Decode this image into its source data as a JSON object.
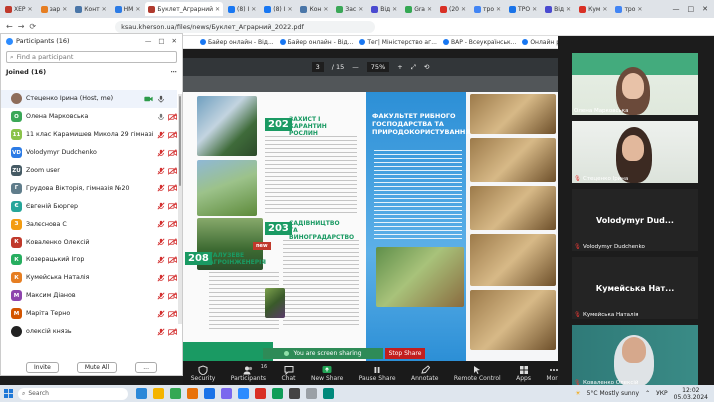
{
  "browser": {
    "tabs": [
      {
        "label": "ХЕР",
        "color": "#c0392b"
      },
      {
        "label": "зар",
        "color": "#e67e22"
      },
      {
        "label": "Конт",
        "color": "#4a76a8"
      },
      {
        "label": "НМ",
        "color": "#2c7be5"
      },
      {
        "label": "Буклет_Аграрний",
        "color": "#b03a2e",
        "active": true
      },
      {
        "label": "(8) I",
        "color": "#1877f2"
      },
      {
        "label": "(8) I",
        "color": "#1877f2"
      },
      {
        "label": "Кон",
        "color": "#4a76a8"
      },
      {
        "label": "Зас",
        "color": "#3aa757"
      },
      {
        "label": "Від",
        "color": "#4a4ad0"
      },
      {
        "label": "Gra",
        "color": "#34a853"
      },
      {
        "label": "(20",
        "color": "#d93025"
      },
      {
        "label": "тро",
        "color": "#4285f4"
      },
      {
        "label": "TPO",
        "color": "#1a73e8"
      },
      {
        "label": "Від",
        "color": "#4a4ad0"
      },
      {
        "label": "Кум",
        "color": "#d93025"
      },
      {
        "label": "тро",
        "color": "#4285f4"
      }
    ],
    "url": "ksau.kherson.ua/files/news/Буклет_Аграрний_2022.pdf",
    "bookmarks": [
      "Байер онлайн - Від...",
      "Байер онлайн - Від...",
      "Тег| Міністерство аг...",
      "ВАР - Всеукраїнськ...",
      "Онлайн резервуван..."
    ]
  },
  "pdf": {
    "page_current": "3",
    "page_total": "/ 15",
    "zoom": "75%",
    "sections": {
      "s202_num": "202",
      "s202_title": "ЗАХИСТ І КАРАНТИН РОСЛИН",
      "s203_num": "203",
      "s203_title": "САДІВНИЦТВО ТА ВИНОГРАДАРСТВО",
      "s208_num": "208",
      "s208_title": "ГАЛУЗЕВЕ АГРОІНЖЕНЕРІЯ",
      "new_badge": "new"
    },
    "faculty_title": "ФАКУЛЬТЕТ РИБНОГО ГОСПОДАРСТВА ТА ПРИРОДОКОРИСТУВАННЯ"
  },
  "sharing": {
    "banner": "You are screen sharing",
    "stop": "Stop Share"
  },
  "participants_panel": {
    "title": "Participants (16)",
    "search_placeholder": "Find a participant",
    "joined_label": "Joined (16)",
    "invite": "Invite",
    "mute_all": "Mute All",
    "more": "...",
    "list": [
      {
        "initials": "",
        "name": "Стеценко Ірина (Host, me)",
        "color": "#8e6d5a",
        "mic": "on",
        "video": "on",
        "highlight": true
      },
      {
        "initials": "О",
        "name": "Олена Марковська",
        "color": "#3aa757",
        "mic": "muted-plain",
        "video": "off"
      },
      {
        "initials": "11",
        "name": "11 клас Карамишев Микола 29 гімназія",
        "color": "#8bc34a",
        "mic": "off",
        "video": "off"
      },
      {
        "initials": "VD",
        "name": "Volodymyr Dudchenko",
        "color": "#2c7be5",
        "mic": "off",
        "video": "off"
      },
      {
        "initials": "ZU",
        "name": "Zoom user",
        "color": "#455a64",
        "mic": "off",
        "video": "off"
      },
      {
        "initials": "Г",
        "name": "Грудова Вікторія, гімназія №20",
        "color": "#607d8b",
        "mic": "off",
        "video": "off"
      },
      {
        "initials": "Є",
        "name": "Євгеній Бюргер",
        "color": "#26a69a",
        "mic": "off",
        "video": "off"
      },
      {
        "initials": "З",
        "name": "Залєснова С",
        "color": "#f39c12",
        "mic": "off",
        "video": "off"
      },
      {
        "initials": "К",
        "name": "Коваленко Олексій",
        "color": "#c0392b",
        "mic": "off",
        "video": "off"
      },
      {
        "initials": "К",
        "name": "Козерацький Ігор",
        "color": "#27ae60",
        "mic": "off",
        "video": "off"
      },
      {
        "initials": "К",
        "name": "Кумейська Наталія",
        "color": "#e67e22",
        "mic": "off",
        "video": "off"
      },
      {
        "initials": "М",
        "name": "Максим Діанов",
        "color": "#8e44ad",
        "mic": "off",
        "video": "off"
      },
      {
        "initials": "М",
        "name": "Марiта Терно",
        "color": "#d35400",
        "mic": "off",
        "video": "off"
      },
      {
        "initials": "",
        "name": "олексій князь",
        "color": "#222222",
        "mic": "off",
        "video": "off"
      }
    ]
  },
  "toolbar": {
    "items": [
      "Security",
      "Participants",
      "Chat",
      "New Share",
      "Pause Share",
      "Annotate",
      "Remote Control",
      "Apps",
      "More"
    ],
    "participants_count": "16"
  },
  "gallery": {
    "tiles": [
      {
        "name": "Олена Марковська",
        "type": "video",
        "muted": false
      },
      {
        "name": "Стеценко Ірина",
        "type": "video",
        "muted": true
      },
      {
        "name": "Volodymyr Dudchenko",
        "big": "Volodymyr Dud...",
        "type": "name",
        "muted": true
      },
      {
        "name": "Кумейська Наталія",
        "big": "Кумейська Нат...",
        "type": "name",
        "muted": true
      },
      {
        "name": "Коваленко Олексій",
        "type": "video",
        "muted": true
      }
    ]
  },
  "taskbar": {
    "search": "Search",
    "weather": "5°C Mostly sunny",
    "lang": "УКР",
    "time": "12:02",
    "date": "05.03.2024",
    "icons": [
      "#2b88d8",
      "#f4b400",
      "#34a853",
      "#e8710a",
      "#1a73e8",
      "#7b68ee",
      "#2d8cff",
      "#d93025",
      "#0f9d58",
      "#444",
      "#9aa0a6",
      "#00897b"
    ]
  }
}
